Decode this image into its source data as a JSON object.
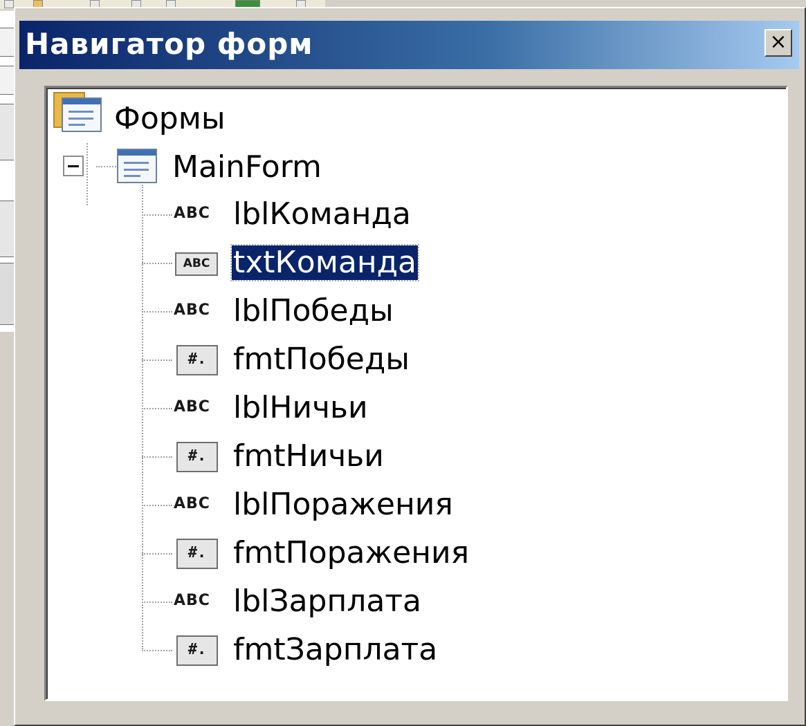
{
  "window": {
    "title": "Навигатор форм",
    "close_symbol": "×",
    "accent_color": "#0a246a",
    "face_color": "#d4d0c8"
  },
  "tree": {
    "root": {
      "label": "Формы",
      "icon": "forms-folder-icon"
    },
    "form": {
      "label": "MainForm",
      "icon": "form-icon",
      "expanded": true
    },
    "controls": [
      {
        "label": "lblКоманда",
        "icon": "label-field-icon",
        "icon_text": "ABC",
        "selected": false
      },
      {
        "label": "txtКоманда",
        "icon": "text-box-icon",
        "icon_text": "ABC",
        "selected": true
      },
      {
        "label": "lblПобеды",
        "icon": "label-field-icon",
        "icon_text": "ABC",
        "selected": false
      },
      {
        "label": "fmtПобеды",
        "icon": "formatted-field-icon",
        "icon_text": "#.",
        "selected": false
      },
      {
        "label": "lblНичьи",
        "icon": "label-field-icon",
        "icon_text": "ABC",
        "selected": false
      },
      {
        "label": "fmtНичьи",
        "icon": "formatted-field-icon",
        "icon_text": "#.",
        "selected": false
      },
      {
        "label": "lblПоражения",
        "icon": "label-field-icon",
        "icon_text": "ABC",
        "selected": false
      },
      {
        "label": "fmtПоражения",
        "icon": "formatted-field-icon",
        "icon_text": "#.",
        "selected": false
      },
      {
        "label": "lblЗарплата",
        "icon": "label-field-icon",
        "icon_text": "ABC",
        "selected": false
      },
      {
        "label": "fmtЗарплата",
        "icon": "formatted-field-icon",
        "icon_text": "#.",
        "selected": false
      }
    ]
  }
}
